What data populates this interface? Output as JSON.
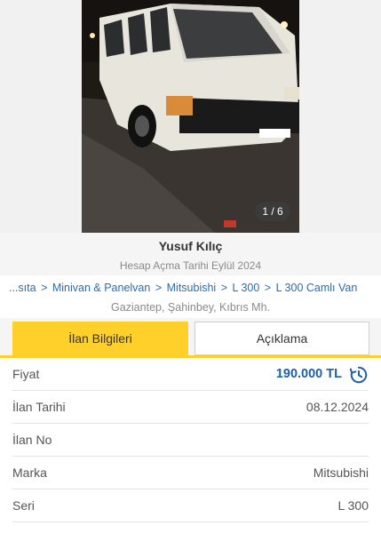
{
  "gallery": {
    "counter": "1 / 6"
  },
  "seller": {
    "name": "Yusuf Kılıç",
    "join_date": "Hesap Açma Tarihi Eylül 2024"
  },
  "breadcrumb": [
    "...sıta",
    "Minivan & Panelvan",
    "Mitsubishi",
    "L 300",
    "L 300 Camlı Van"
  ],
  "breadcrumb_separator": ">",
  "location": "Gaziantep, Şahinbey, Kıbrıs Mh.",
  "tabs": {
    "info": "İlan Bilgileri",
    "description": "Açıklama"
  },
  "details": [
    {
      "label": "Fiyat",
      "value": "190.000 TL"
    },
    {
      "label": "İlan Tarihi",
      "value": "08.12.2024"
    },
    {
      "label": "İlan No",
      "value": ""
    },
    {
      "label": "Marka",
      "value": "Mitsubishi"
    },
    {
      "label": "Seri",
      "value": "L 300"
    }
  ],
  "colors": {
    "accent": "#ffd02a",
    "link": "#2b6cb0",
    "price": "#1d5fa8"
  },
  "icons": {
    "price_history": "history-icon"
  }
}
